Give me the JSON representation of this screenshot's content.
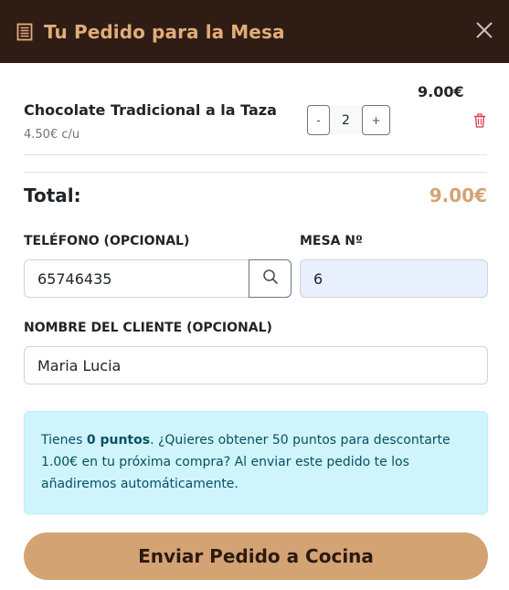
{
  "header": {
    "title": "Tu Pedido para la Mesa",
    "icon": "receipt-icon",
    "close_icon": "close-icon",
    "accent_color": "#e0ad78",
    "background_color": "#2f1c15"
  },
  "cart": {
    "items": [
      {
        "name": "Chocolate Tradicional a la Taza",
        "unit_price": "4.50€ c/u",
        "quantity": "2",
        "minus_label": "-",
        "plus_label": "+",
        "total": "9.00€",
        "delete_icon": "trash-icon"
      }
    ]
  },
  "summary": {
    "total_label": "Total:",
    "total_value": "9.00€",
    "total_color": "#d4a373"
  },
  "form": {
    "phone_label": "TELÉFONO (OPCIONAL)",
    "phone_value": "65746435",
    "search_icon": "search-icon",
    "table_label": "MESA Nº",
    "table_value": "6",
    "name_label": "NOMBRE DEL CLIENTE (OPCIONAL)",
    "name_value": "Maria Lucia"
  },
  "points_alert": {
    "prefix": "Tienes ",
    "points": "0 puntos",
    "message": ". ¿Quieres obtener 50 puntos para descontarte 1.00€ en tu próxima compra? Al enviar este pedido te los añadiremos automáticamente."
  },
  "actions": {
    "submit_label": "Enviar Pedido a Cocina",
    "submit_color": "#d4a373"
  }
}
